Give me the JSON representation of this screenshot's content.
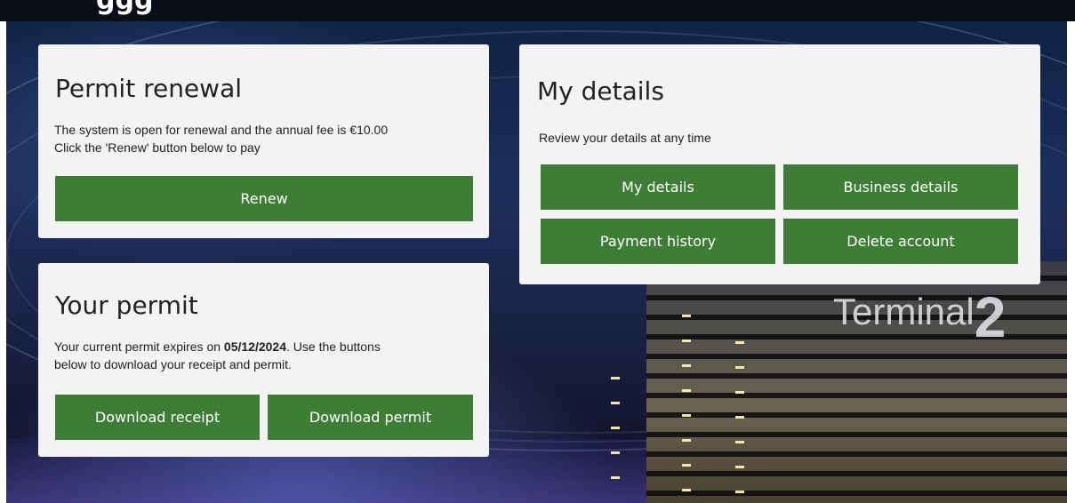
{
  "top_banner": {
    "partial_text": "ggg"
  },
  "background": {
    "sign_text": "Terminal",
    "sign_number": "2"
  },
  "permit_renewal": {
    "title": "Permit renewal",
    "line1": "The system is open for renewal and the annual fee is €10.00",
    "line2": "Click the 'Renew' button below to pay",
    "renew_label": "Renew"
  },
  "your_permit": {
    "title": "Your permit",
    "text_prefix": "Your current permit expires on ",
    "expiry_date": "05/12/2024",
    "text_suffix": ". Use the buttons",
    "line2": "below to download your receipt and permit.",
    "download_receipt_label": "Download receipt",
    "download_permit_label": "Download permit"
  },
  "my_details": {
    "title": "My details",
    "subtitle": "Review your details at any time",
    "buttons": {
      "my_details": "My details",
      "business_details": "Business details",
      "payment_history": "Payment history",
      "delete_account": "Delete account"
    }
  },
  "colors": {
    "button_green": "#3e7d35",
    "card_bg": "#f3f3f3",
    "top_strip": "#0b0d18"
  }
}
